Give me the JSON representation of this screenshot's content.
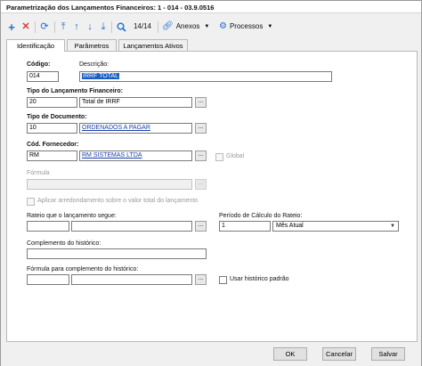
{
  "window": {
    "title": "Parametrização dos Lançamentos Financeiros: 1 - 014 - 03.9.0516"
  },
  "toolbar": {
    "add_icon": "plus-icon",
    "delete_icon": "x-icon",
    "refresh_icon": "refresh-icon",
    "nav_first_icon": "arrow-first-icon",
    "nav_prev_icon": "arrow-up-icon",
    "nav_next_icon": "arrow-down-icon",
    "nav_last_icon": "arrow-last-icon",
    "search_icon": "magnifier-icon",
    "record_counter": "14/14",
    "attachments_label": "Anexos",
    "processes_label": "Processos",
    "accent": "#1f6fd1",
    "delete_color": "#d13b3b"
  },
  "tabs": [
    {
      "label": "Identificação",
      "active": true
    },
    {
      "label": "Parâmetros",
      "active": false
    },
    {
      "label": "Lançamentos Ativos",
      "active": false
    }
  ],
  "form": {
    "codigo_label": "Código:",
    "codigo_value": "014",
    "descricao_label": "Descrição:",
    "descricao_value": "IRRF TOTAL",
    "tipo_lancamento_label": "Tipo do Lançamento Financeiro:",
    "tipo_lancamento_code": "20",
    "tipo_lancamento_desc": "Total de IRRF",
    "tipo_documento_label": "Tipo de Documento:",
    "tipo_documento_code": "10",
    "tipo_documento_desc": "ORDENADOS A PAGAR",
    "fornecedor_label": "Cód. Fornecedor:",
    "fornecedor_code": "RM",
    "fornecedor_desc": "RM SISTEMAS LTDA",
    "global_label": "Global",
    "formula_label": "Fórmula",
    "formula_value": "",
    "arredondamento_label": "Aplicar arredondamento sobre o valor total do lançamento",
    "rateio_label": "Rateio que o lançamento segue:",
    "rateio_value": "",
    "periodo_label": "Período de Cálculo do Rateio:",
    "periodo_value": "1",
    "periodo_option": "Mês Atual",
    "complemento_label": "Complemento do histórico:",
    "complemento_value": "",
    "formula_complemento_label": "Fórmula para complemento do histórico:",
    "formula_complemento_value": "",
    "historico_padrao_label": "Usar histórico padrão",
    "ellipsis": "..."
  },
  "footer": {
    "ok_label": "OK",
    "cancel_label": "Cancelar",
    "save_label": "Salvar"
  }
}
